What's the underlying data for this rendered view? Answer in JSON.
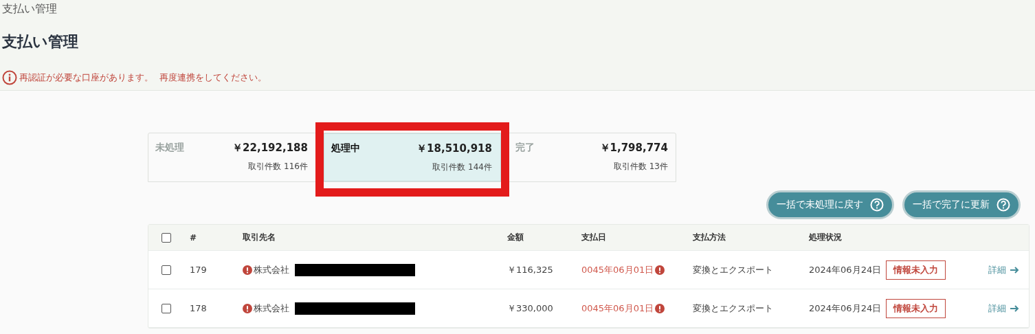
{
  "breadcrumb": "支払い管理",
  "title": "支払い管理",
  "alert": {
    "message": "再認証が必要な口座があります。",
    "link": "再度連携をしてください。"
  },
  "tabs": [
    {
      "label": "未処理",
      "amount": "￥22,192,188",
      "count": "取引件数 116件",
      "selected": false
    },
    {
      "label": "処理中",
      "amount": "￥18,510,918",
      "count": "取引件数 144件",
      "selected": true
    },
    {
      "label": "完了",
      "amount": "￥1,798,774",
      "count": "取引件数 13件",
      "selected": false
    }
  ],
  "bulk_buttons": [
    {
      "label": "一括で未処理に戻す"
    },
    {
      "label": "一括で完了に更新"
    }
  ],
  "table": {
    "select_all_checked": false,
    "columns": [
      "#",
      "取引先名",
      "金額",
      "支払日",
      "支払方法",
      "処理状況"
    ],
    "rows": [
      {
        "checked": false,
        "number": "179",
        "payee": "株式会社",
        "payee_warning": true,
        "amount": "￥116,325",
        "pay_date": "0045年06月01日",
        "date_warning": true,
        "method": "変換とエクスポート",
        "status_date": "2024年06月24日",
        "badge": "情報未入力",
        "action": "詳細"
      },
      {
        "checked": false,
        "number": "178",
        "payee": "株式会社",
        "payee_warning": true,
        "amount": "￥330,000",
        "pay_date": "0045年06月01日",
        "date_warning": true,
        "method": "変換とエクスポート",
        "status_date": "2024年06月24日",
        "badge": "情報未入力",
        "action": "詳細"
      }
    ]
  }
}
